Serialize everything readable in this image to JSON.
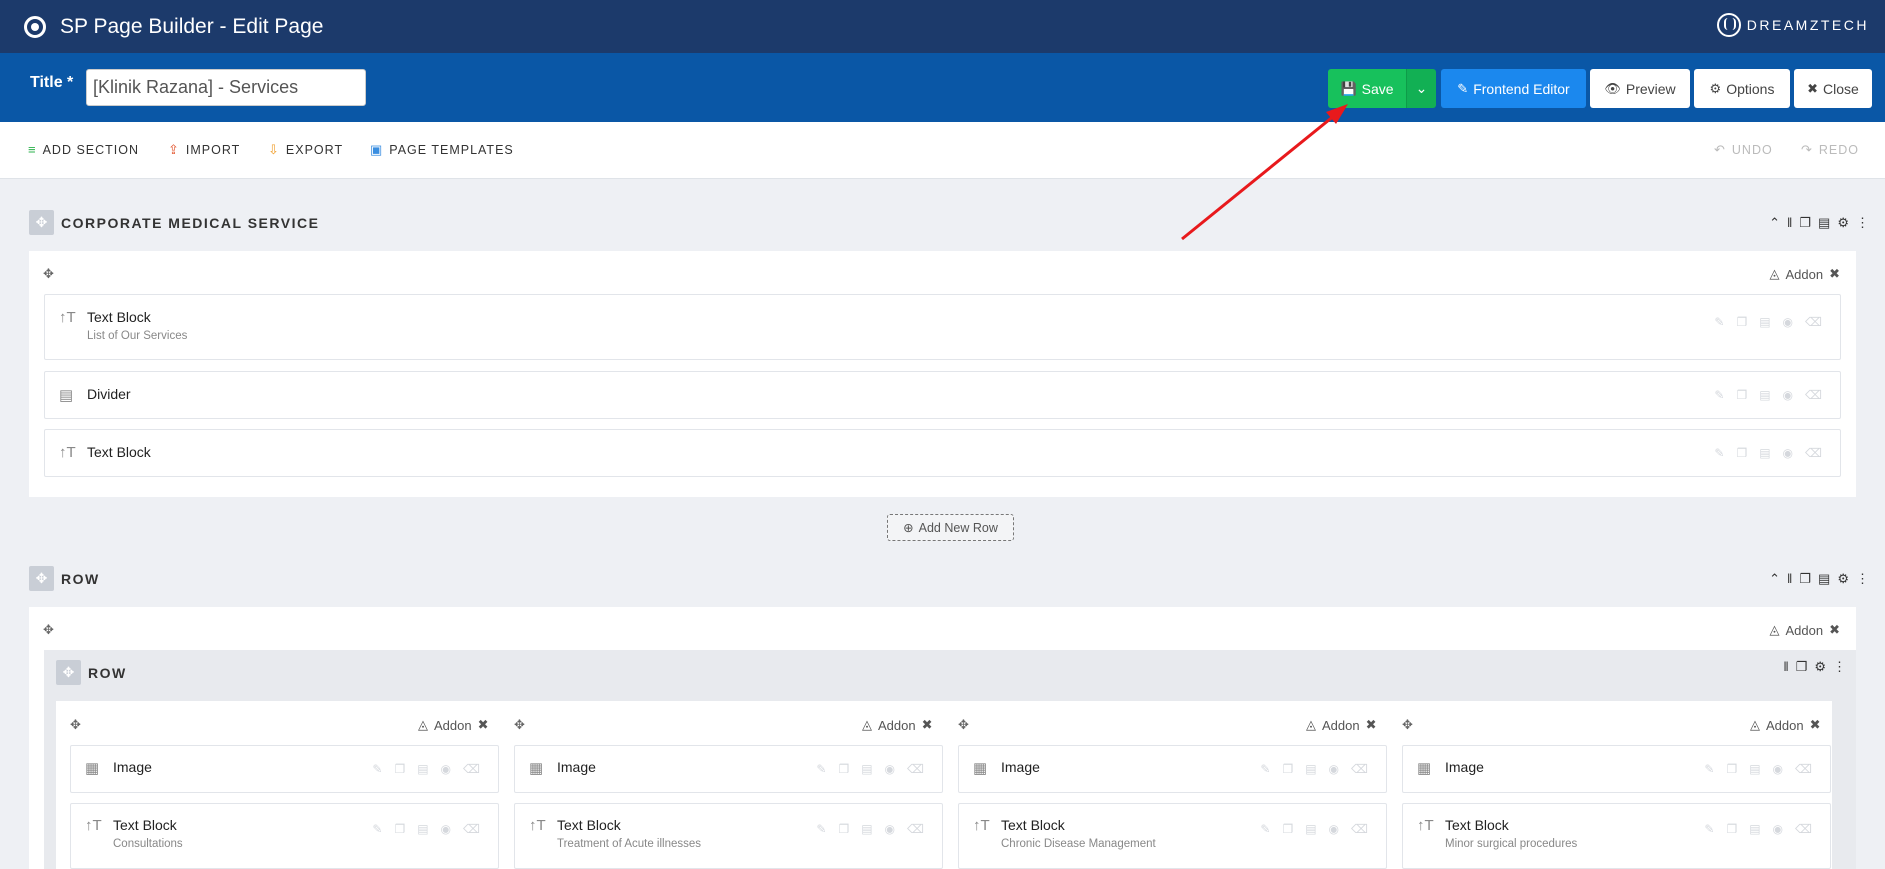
{
  "topbar": {
    "title": "SP Page Builder - Edit Page",
    "brand": "DREAMZTECH"
  },
  "titlebar": {
    "label": "Title *",
    "value": "[Klinik Razana] - Services",
    "save": "Save",
    "frontend_editor": "Frontend Editor",
    "preview": "Preview",
    "options": "Options",
    "close": "Close"
  },
  "toolbar": {
    "add_section": "ADD SECTION",
    "import": "IMPORT",
    "export": "EXPORT",
    "page_templates": "PAGE TEMPLATES",
    "undo": "UNDO",
    "redo": "REDO"
  },
  "sections": [
    {
      "title": "CORPORATE MEDICAL SERVICE",
      "addon_label": "Addon",
      "addons": [
        {
          "icon": "text-block-icon",
          "name": "Text Block",
          "subtitle": "List of Our Services"
        },
        {
          "icon": "divider-icon",
          "name": "Divider",
          "subtitle": ""
        },
        {
          "icon": "text-block-icon",
          "name": "Text Block",
          "subtitle": ""
        }
      ]
    },
    {
      "title": "ROW",
      "addon_label": "Addon",
      "inner_row": {
        "title": "ROW",
        "columns": [
          {
            "addon_label": "Addon",
            "image": "Image",
            "text": "Text Block",
            "subtitle": "Consultations"
          },
          {
            "addon_label": "Addon",
            "image": "Image",
            "text": "Text Block",
            "subtitle": "Treatment of Acute illnesses"
          },
          {
            "addon_label": "Addon",
            "image": "Image",
            "text": "Text Block",
            "subtitle": "Chronic Disease Management"
          },
          {
            "addon_label": "Addon",
            "image": "Image",
            "text": "Text Block",
            "subtitle": "Minor surgical procedures"
          }
        ]
      }
    }
  ],
  "add_new_row": "Add New Row",
  "colors": {
    "topbar": "#1c3a6b",
    "titlebar": "#0a57a6",
    "save": "#17c15c",
    "frontend": "#1b88ee",
    "annotation_arrow": "#e8191c"
  }
}
